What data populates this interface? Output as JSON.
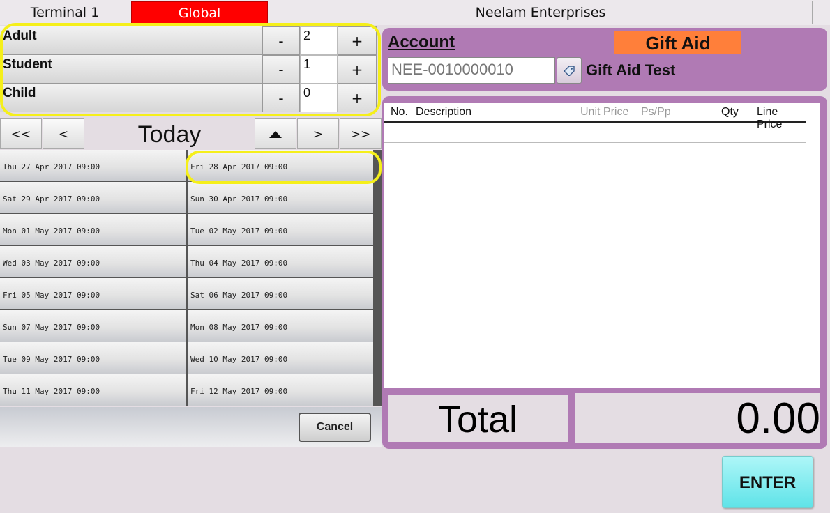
{
  "topbar": {
    "terminal": "Terminal 1",
    "global": "Global",
    "company": "Neelam Enterprises"
  },
  "tickets": [
    {
      "label": "Adult",
      "qty": "2",
      "minus": "-",
      "plus": "+"
    },
    {
      "label": "Student",
      "qty": "1",
      "minus": "-",
      "plus": "+"
    },
    {
      "label": "Child",
      "qty": "0",
      "minus": "-",
      "plus": "+"
    }
  ],
  "date_nav": {
    "first": "<<",
    "prev": "<",
    "today": "Today",
    "up_icon": "up-arrow-icon",
    "next": ">",
    "last": ">>"
  },
  "dates": [
    "Thu 27 Apr 2017 09:00",
    "Fri 28 Apr 2017 09:00",
    "Sat 29 Apr 2017 09:00",
    "Sun 30 Apr 2017 09:00",
    "Mon 01 May 2017 09:00",
    "Tue 02 May 2017 09:00",
    "Wed 03 May 2017 09:00",
    "Thu 04 May 2017 09:00",
    "Fri 05 May 2017 09:00",
    "Sat 06 May 2017 09:00",
    "Sun 07 May 2017 09:00",
    "Mon 08 May 2017 09:00",
    "Tue 09 May 2017 09:00",
    "Wed 10 May 2017 09:00",
    "Thu 11 May 2017 09:00",
    "Fri 12 May 2017 09:00"
  ],
  "cancel_label": "Cancel",
  "account": {
    "label": "Account",
    "value": "NEE-0010000010",
    "tag_icon": "tag-icon",
    "gift_aid_badge": "Gift Aid",
    "gift_aid_test": "Gift Aid Test"
  },
  "order": {
    "columns": {
      "no": "No.",
      "description": "Description",
      "unit_price": "Unit Price",
      "ps_pp": "Ps/Pp",
      "qty": "Qty",
      "line_price": "Line Price"
    },
    "total_label": "Total",
    "total_value": "0.00"
  },
  "enter_label": "ENTER",
  "colors": {
    "global_red": "#ff0000",
    "panel_purple": "#b07ab4",
    "gift_aid_orange": "#ff7f3a",
    "enter_cyan": "#5fe3e8",
    "highlight_yellow": "#f5ef1a"
  }
}
